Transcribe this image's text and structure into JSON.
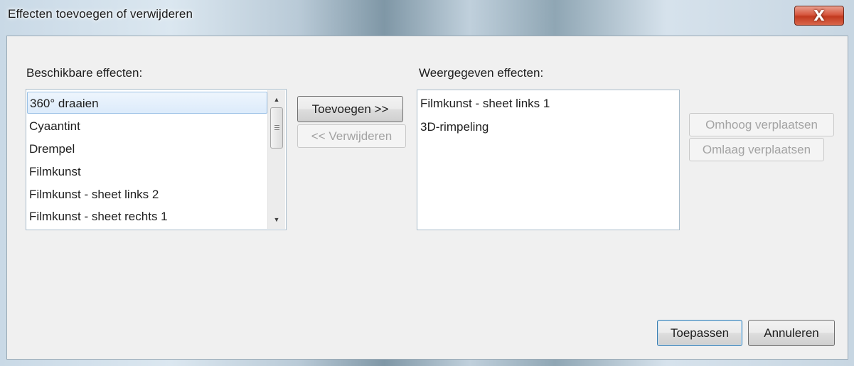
{
  "window": {
    "title": "Effecten toevoegen of verwijderen",
    "close_glyph": "X"
  },
  "available": {
    "label": "Beschikbare effecten:",
    "items": [
      {
        "label": "360° draaien",
        "selected": true
      },
      {
        "label": "Cyaantint"
      },
      {
        "label": "Drempel"
      },
      {
        "label": "Filmkunst"
      },
      {
        "label": "Filmkunst - sheet links 2"
      },
      {
        "label": "Filmkunst - sheet rechts 1"
      }
    ],
    "scroll_up_glyph": "▲",
    "scroll_down_glyph": "▼"
  },
  "middle_buttons": {
    "add_label": "Toevoegen >>",
    "remove_label": "<< Verwijderen"
  },
  "shown": {
    "label": "Weergegeven effecten:",
    "items": [
      {
        "label": "Filmkunst - sheet links 1"
      },
      {
        "label": "3D-rimpeling"
      }
    ]
  },
  "right_buttons": {
    "up_label": "Omhoog verplaatsen",
    "down_label": "Omlaag verplaatsen"
  },
  "footer": {
    "apply_label": "Toepassen",
    "cancel_label": "Annuleren"
  },
  "colors": {
    "close_button": "#c9452a",
    "selection": "#dcebfb",
    "dialog_bg": "#f0f0f0"
  }
}
